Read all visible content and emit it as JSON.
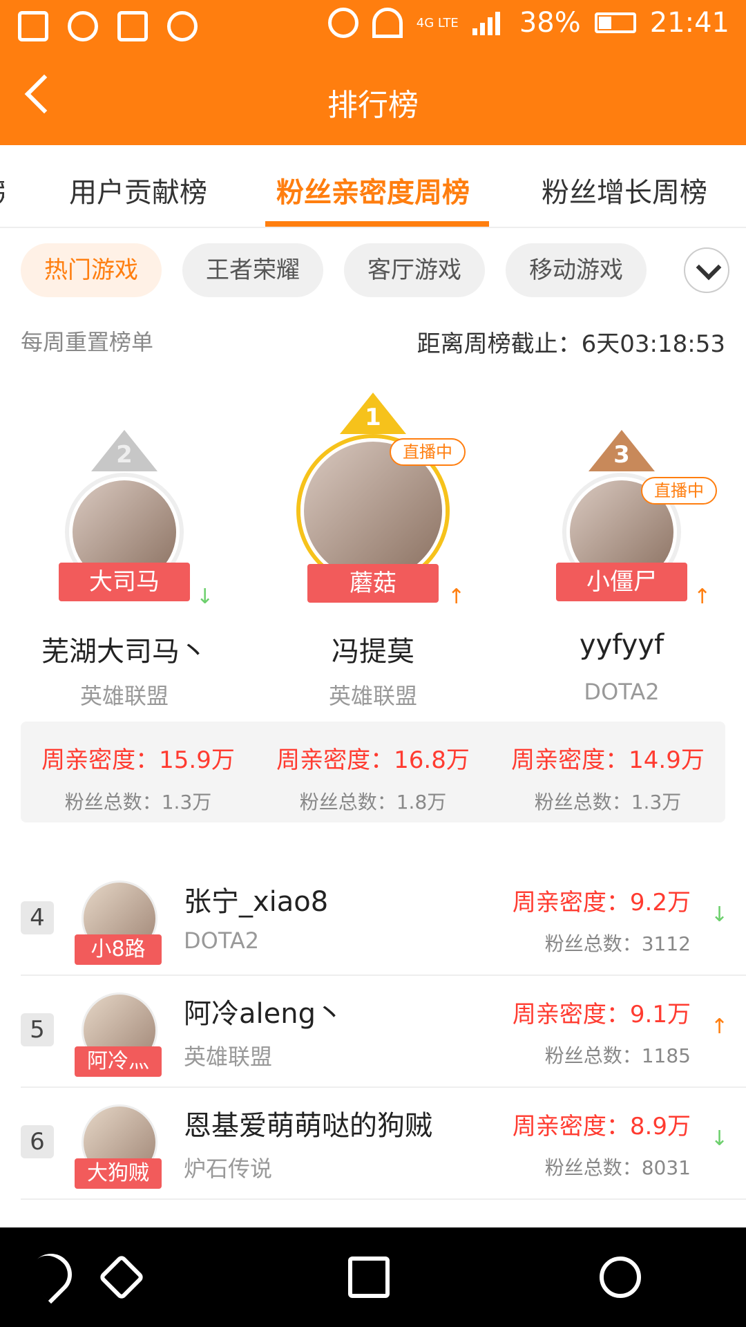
{
  "status_bar": {
    "network": "4G LTE",
    "battery": "38%",
    "time": "21:41"
  },
  "header": {
    "title": "排行榜"
  },
  "tabs": [
    {
      "label": "用户贡献榜"
    },
    {
      "label": "粉丝亲密度周榜"
    },
    {
      "label": "粉丝增长周榜"
    }
  ],
  "chips": [
    {
      "label": "热门游戏"
    },
    {
      "label": "王者荣耀"
    },
    {
      "label": "客厅游戏"
    },
    {
      "label": "移动游戏"
    }
  ],
  "info": {
    "reset_note": "每周重置榜单",
    "countdown": "距离周榜截止：6天03:18:53"
  },
  "podium": [
    {
      "rank": "2",
      "tag": "大司马",
      "name": "芜湖大司马丶",
      "game": "英雄联盟",
      "live": "",
      "affinity": "周亲密度：15.9万",
      "fans": "粉丝总数：1.3万"
    },
    {
      "rank": "1",
      "tag": "蘑菇",
      "name": "冯提莫",
      "game": "英雄联盟",
      "live": "直播中",
      "affinity": "周亲密度：16.8万",
      "fans": "粉丝总数：1.8万"
    },
    {
      "rank": "3",
      "tag": "小僵尸",
      "name": "yyfyyf",
      "game": "DOTA2",
      "live": "直播中",
      "affinity": "周亲密度：14.9万",
      "fans": "粉丝总数：1.3万"
    }
  ],
  "list": [
    {
      "rank": "4",
      "tag": "小8路",
      "name": "张宁_xiao8",
      "game": "DOTA2",
      "affinity": "周亲密度：9.2万",
      "fans": "粉丝总数：3112"
    },
    {
      "rank": "5",
      "tag": "阿冷灬",
      "name": "阿冷aleng丶",
      "game": "英雄联盟",
      "affinity": "周亲密度：9.1万",
      "fans": "粉丝总数：1185"
    },
    {
      "rank": "6",
      "tag": "大狗贼",
      "name": "恩基爱萌萌哒的狗贼",
      "game": "炉石传说",
      "affinity": "周亲密度：8.9万",
      "fans": "粉丝总数：8031"
    }
  ],
  "colors": {
    "accent": "#ff7e0f",
    "affinity": "#ff3b30",
    "up": "#ff7e0f",
    "down": "#6ccf6c"
  }
}
